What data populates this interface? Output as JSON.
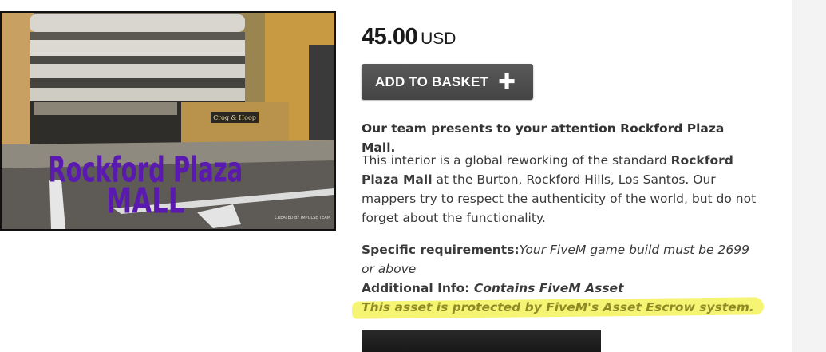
{
  "product": {
    "image_title_line1": "Rockford Plaza",
    "image_title_line2": "MALL",
    "image_store_sign": "Crog & Hoop",
    "image_watermark": "CREATED BY IMPULSE TEAM",
    "price_amount": "45.00",
    "price_currency": "USD",
    "add_button_label": "ADD TO BASKET",
    "add_button_icon": "plus-icon",
    "intro": "Our team presents to your attention Rockford Plaza Mall.",
    "body_before": "This interior is a global reworking of the standard ",
    "body_bold": "Rockford Plaza Mall",
    "body_after": " at the Burton, Rockford Hills, Los Santos. Our mappers try to respect the authenticity of the world, but do not forget about the functionality.",
    "req_label": "Specific requirements:",
    "req_value": "Your FiveM game build must be 2699 or above",
    "add_info_label": "Additional Info: ",
    "add_info_value": "Contains FiveM Asset",
    "escrow_notice": "This asset is protected by FiveM's Asset Escrow system."
  },
  "colors": {
    "button_bg": "#4e4e4e",
    "highlight": "#f4f25a",
    "title_purple": "#5a1ab0"
  }
}
